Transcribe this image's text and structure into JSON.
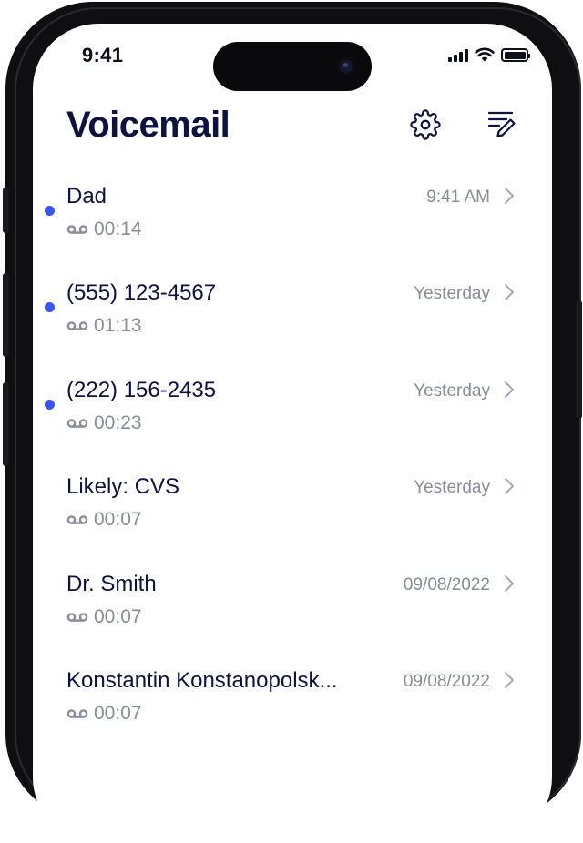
{
  "status_bar": {
    "time": "9:41"
  },
  "header": {
    "title": "Voicemail",
    "settings_icon": "gear-icon",
    "compose_icon": "compose-icon"
  },
  "colors": {
    "title": "#0d1240",
    "unread_dot": "#3b55e6",
    "secondary_text": "#8a8c9a"
  },
  "voicemails": [
    {
      "name": "Dad",
      "duration": "00:14",
      "date": "9:41 AM",
      "unread": true
    },
    {
      "name": "(555) 123-4567",
      "duration": "01:13",
      "date": "Yesterday",
      "unread": true
    },
    {
      "name": "(222) 156-2435",
      "duration": "00:23",
      "date": "Yesterday",
      "unread": true
    },
    {
      "name": "Likely: CVS",
      "duration": "00:07",
      "date": "Yesterday",
      "unread": false
    },
    {
      "name": "Dr. Smith",
      "duration": "00:07",
      "date": "09/08/2022",
      "unread": false
    },
    {
      "name": "Konstantin Konstanopolsk...",
      "duration": "00:07",
      "date": "09/08/2022",
      "unread": false
    }
  ]
}
